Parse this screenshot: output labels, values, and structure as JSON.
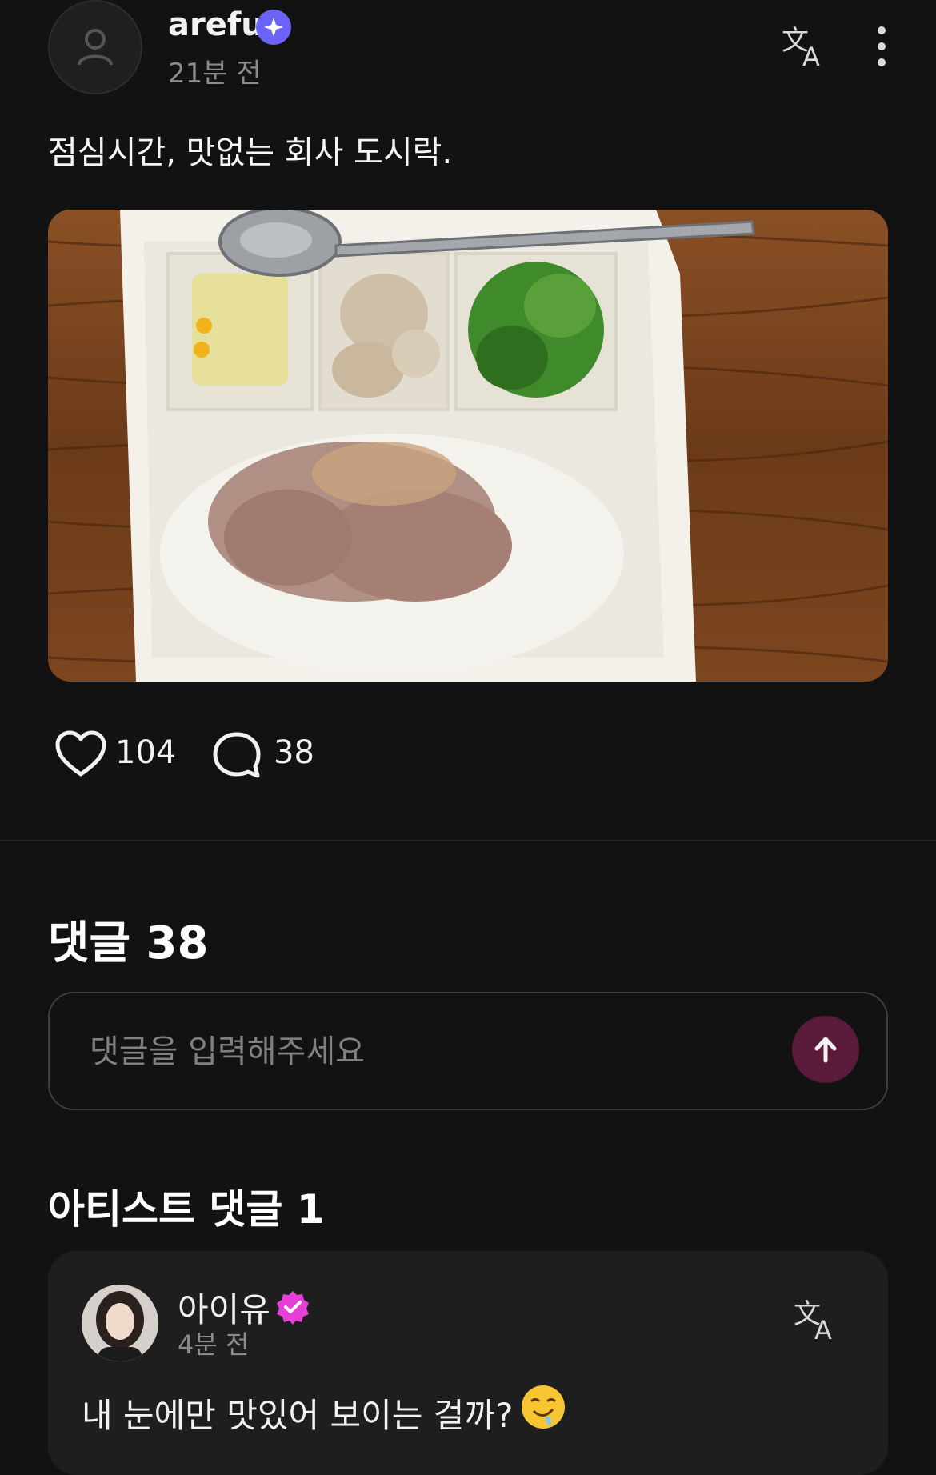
{
  "post": {
    "username": "arefu",
    "time": "21분 전",
    "text": "점심시간, 맛없는 회사 도시락.",
    "likes": "104",
    "comments": "38",
    "image_icon": "photo-lunchbox"
  },
  "comments_section": {
    "title": "댓글 38",
    "placeholder": "댓글을 입력해주세요"
  },
  "artist_section": {
    "title": "아티스트 댓글 1",
    "comment": {
      "name": "아이유",
      "time": "4분 전",
      "text": "내 눈에만 맛있어 보이는 걸까?"
    }
  },
  "colors": {
    "background": "#121212",
    "card": "#1e1e1e",
    "verified_blue": "#6b63f6",
    "verified_pink": "#e63ed6",
    "send_button": "#5a1a3a"
  }
}
